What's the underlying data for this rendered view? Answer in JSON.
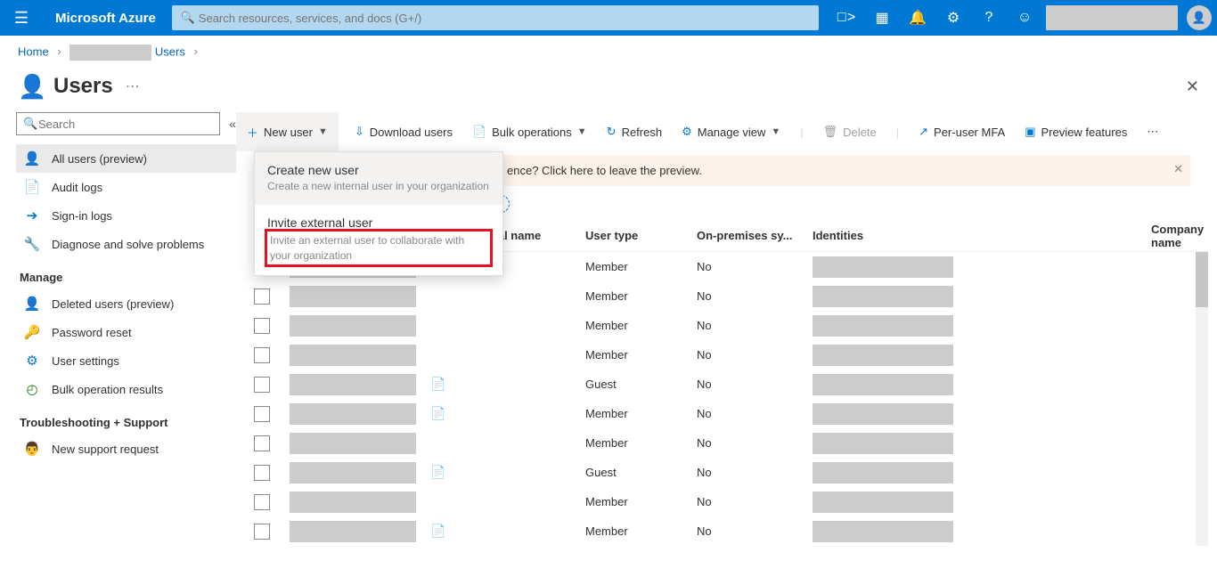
{
  "top": {
    "brand": "Microsoft Azure",
    "search_placeholder": "Search resources, services, and docs (G+/)"
  },
  "breadcrumb": {
    "home": "Home",
    "users": "Users"
  },
  "title": "Users",
  "leftSearchPlaceholder": "Search",
  "nav": {
    "all_users": "All users (preview)",
    "audit": "Audit logs",
    "signin": "Sign-in logs",
    "diag": "Diagnose and solve problems",
    "manage": "Manage",
    "deleted": "Deleted users (preview)",
    "pwreset": "Password reset",
    "usettings": "User settings",
    "bulk": "Bulk operation results",
    "trouble": "Troubleshooting + Support",
    "support": "New support request"
  },
  "toolbar": {
    "newuser": "New user",
    "download": "Download users",
    "bulk": "Bulk operations",
    "refresh": "Refresh",
    "manage": "Manage view",
    "delete": "Delete",
    "mfa": "Per-user MFA",
    "preview": "Preview features"
  },
  "dropdown": {
    "create_t": "Create new user",
    "create_d": "Create a new internal user in your organization",
    "invite_t": "Invite external user",
    "invite_d": "Invite an external user to collaborate with your organization"
  },
  "bannerTail": "ence? Click here to leave the preview.",
  "addFilter": "er",
  "columns": {
    "upn": "User principal name",
    "utype": "User type",
    "onprem": "On-premises sy...",
    "ident": "Identities",
    "company": "Company name"
  },
  "rows": [
    {
      "copy": false,
      "type": "Member",
      "onprem": "No"
    },
    {
      "copy": false,
      "type": "Member",
      "onprem": "No"
    },
    {
      "copy": false,
      "type": "Member",
      "onprem": "No"
    },
    {
      "copy": false,
      "type": "Member",
      "onprem": "No"
    },
    {
      "copy": true,
      "type": "Guest",
      "onprem": "No"
    },
    {
      "copy": true,
      "type": "Member",
      "onprem": "No"
    },
    {
      "copy": false,
      "type": "Member",
      "onprem": "No"
    },
    {
      "copy": true,
      "type": "Guest",
      "onprem": "No"
    },
    {
      "copy": false,
      "type": "Member",
      "onprem": "No"
    },
    {
      "copy": true,
      "type": "Member",
      "onprem": "No"
    }
  ]
}
